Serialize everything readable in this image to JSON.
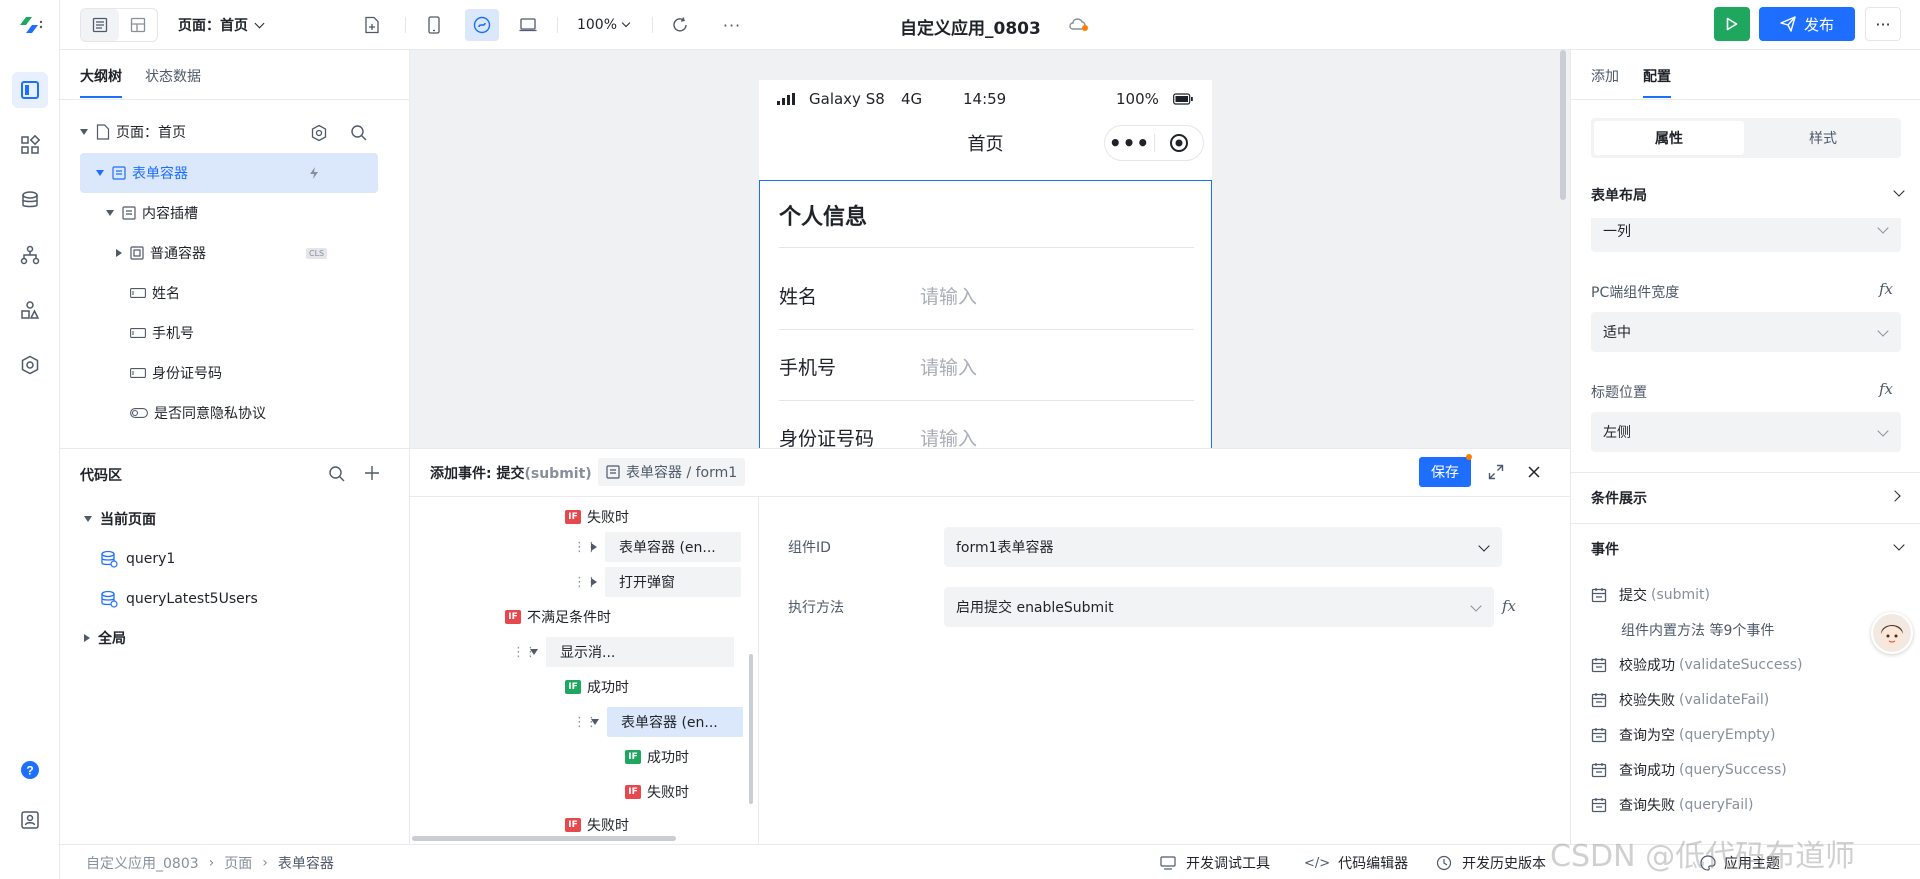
{
  "app": {
    "title": "自定义应用_0803",
    "page_selector": "页面：首页",
    "zoom": "100%"
  },
  "toolbar": {
    "publish_label": "发布",
    "run_icon": "play-icon"
  },
  "outline": {
    "tabs": [
      "大纲树",
      "状态数据"
    ],
    "rows": [
      {
        "label": "页面：首页"
      },
      {
        "label": "表单容器"
      },
      {
        "label": "内容插槽"
      },
      {
        "label": "普通容器",
        "badge": "CLS"
      },
      {
        "label": "姓名"
      },
      {
        "label": "手机号"
      },
      {
        "label": "身份证号码"
      },
      {
        "label": "是否同意隐私协议"
      }
    ]
  },
  "codezone": {
    "title": "代码区",
    "current_page": "当前页面",
    "items": [
      "query1",
      "queryLatest5Users"
    ],
    "global": "全局"
  },
  "phone": {
    "carrier": "Galaxy S8",
    "network": "4G",
    "time": "14:59",
    "battery": "100%",
    "nav_title": "首页",
    "section_title": "个人信息",
    "fields": [
      {
        "label": "姓名",
        "placeholder": "请输入"
      },
      {
        "label": "手机号",
        "placeholder": "请输入"
      },
      {
        "label": "身份证号码",
        "placeholder": "请输入"
      }
    ]
  },
  "event": {
    "title_prefix": "添加事件: 提交",
    "title_suffix": "(submit)",
    "target": "表单容器 / form1",
    "save_label": "保存",
    "flow": [
      {
        "tag": "IF",
        "label": "失败时"
      },
      {
        "label": "表单容器 (en..."
      },
      {
        "label": "打开弹窗"
      },
      {
        "tag": "IF",
        "label": "不满足条件时"
      },
      {
        "label": "显示消..."
      },
      {
        "tag": "IF",
        "label": "成功时"
      },
      {
        "label": "表单容器 (en..."
      },
      {
        "tag": "IF",
        "label": "成功时"
      },
      {
        "tag": "IF",
        "label": "失败时"
      },
      {
        "tag": "IF",
        "label": "失败时"
      }
    ],
    "form": {
      "component_id_label": "组件ID",
      "component_id_value": "form1表单容器",
      "method_label": "执行方法",
      "method_value": "启用提交 enableSubmit"
    }
  },
  "right": {
    "tabs": [
      "添加",
      "配置"
    ],
    "segment": [
      "属性",
      "样式"
    ],
    "form_layout_title": "表单布局",
    "form_layout_value": "一列",
    "pc_width_label": "PC端组件宽度",
    "pc_width_value": "适中",
    "title_pos_label": "标题位置",
    "title_pos_value": "左侧",
    "cond_display": "条件展示",
    "events_title": "事件",
    "events": [
      {
        "name": "提交",
        "en": "(submit)"
      },
      {
        "name": "组件内置方法 等9个事件",
        "en": ""
      },
      {
        "name": "校验成功",
        "en": "(validateSuccess)"
      },
      {
        "name": "校验失败",
        "en": "(validateFail)"
      },
      {
        "name": "查询为空",
        "en": "(queryEmpty)"
      },
      {
        "name": "查询成功",
        "en": "(querySuccess)"
      },
      {
        "name": "查询失败",
        "en": "(queryFail)"
      }
    ]
  },
  "statusbar": {
    "breadcrumb": [
      "自定义应用_0803",
      "页面",
      "表单容器"
    ],
    "tools": [
      "开发调试工具",
      "代码编辑器",
      "开发历史版本",
      "应用主题"
    ],
    "watermark": "CSDN @低代码布道师"
  },
  "colors": {
    "accent": "#1e6fff",
    "run": "#1fa760",
    "if_red": "#e5484d"
  }
}
